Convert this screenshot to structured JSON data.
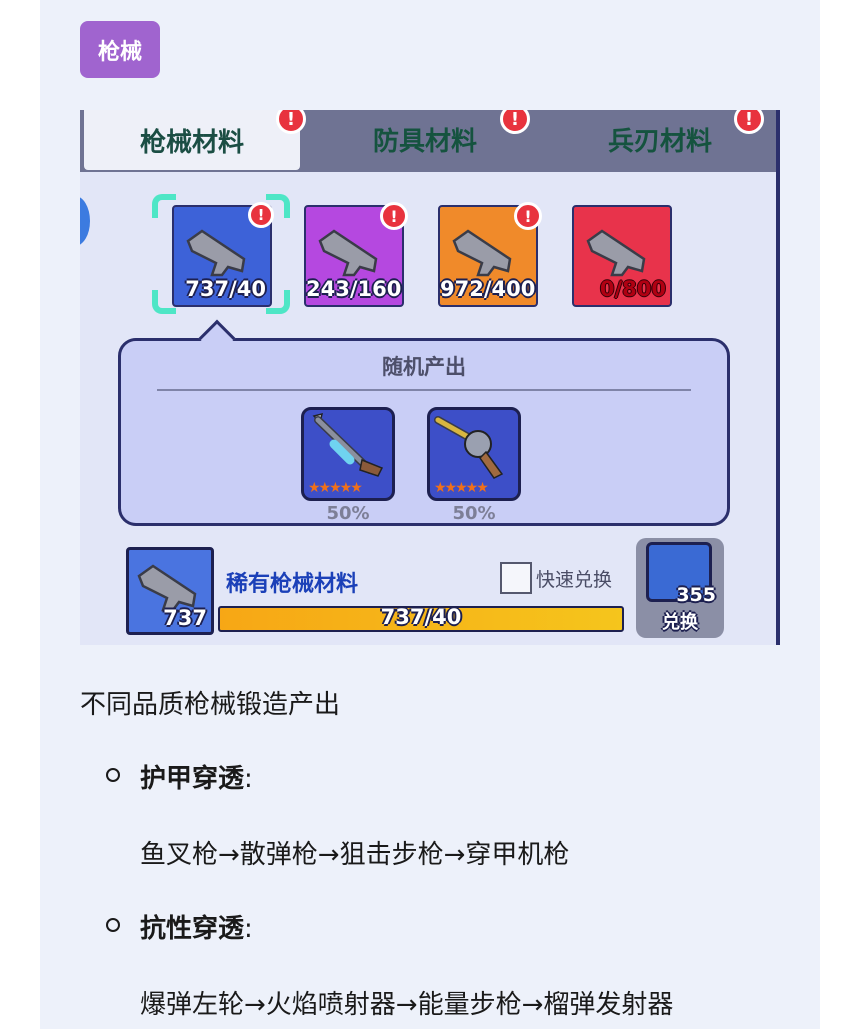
{
  "tag": "枪械",
  "game": {
    "tabs": [
      {
        "label": "枪械材料"
      },
      {
        "label": "防具材料"
      },
      {
        "label": "兵刃材料"
      }
    ],
    "materials": [
      {
        "count": "737/40",
        "color": "#3d62d8"
      },
      {
        "count": "243/160",
        "color": "#b548e0"
      },
      {
        "count": "972/400",
        "color": "#f08a2a"
      },
      {
        "count": "0/800",
        "color": "#e8334b"
      }
    ],
    "panel": {
      "title": "随机产出",
      "rewards": [
        {
          "icon": "harpoon-gun-icon",
          "pct": "50%"
        },
        {
          "icon": "revolver-icon",
          "pct": "50%"
        }
      ]
    },
    "bottom": {
      "count": "737",
      "name": "稀有枪械材料",
      "quick": "快速兑换",
      "progress_text": "737/40",
      "progress": 1.0,
      "exchange_count": "355",
      "exchange_label": "兑换"
    }
  },
  "text": {
    "intro": "不同品质枪械锻造产出",
    "items": [
      {
        "head": "护甲穿透",
        "colon": ":",
        "body": "鱼叉枪→散弹枪→狙击步枪→穿甲机枪"
      },
      {
        "head": "抗性穿透",
        "colon": ":",
        "body": "爆弹左轮→火焰喷射器→能量步枪→榴弹发射器"
      }
    ]
  }
}
